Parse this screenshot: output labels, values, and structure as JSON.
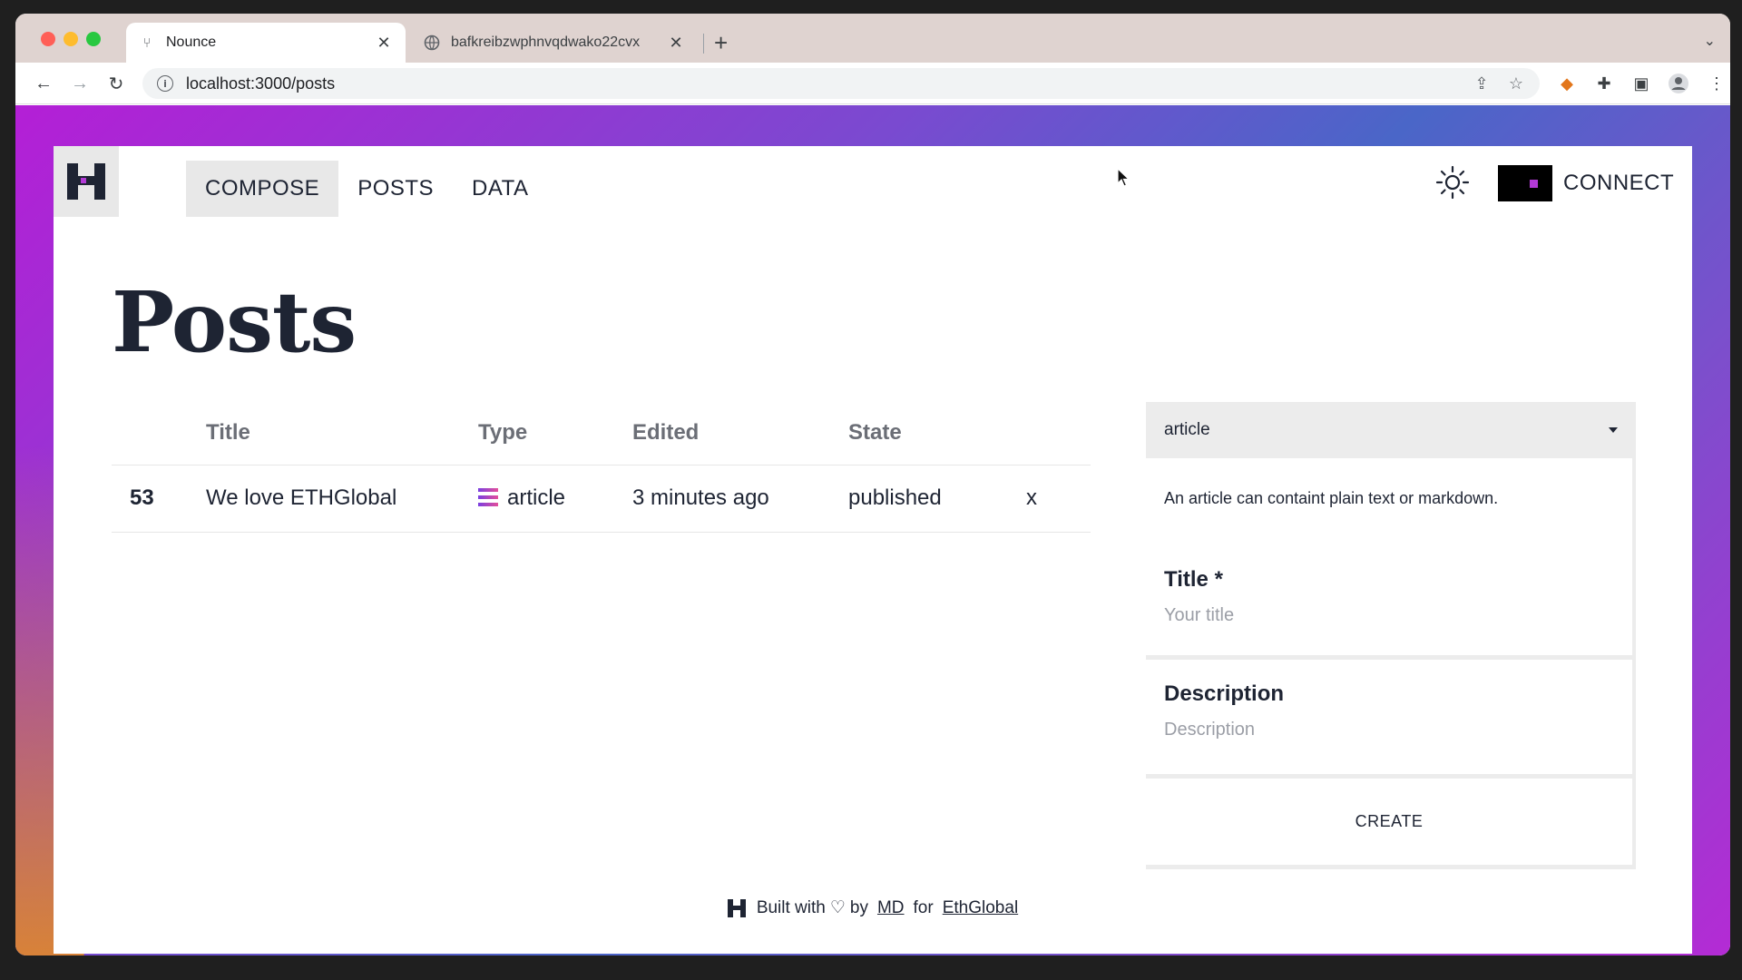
{
  "browser": {
    "tabs": [
      {
        "title": "Nounce",
        "icon": "github-like-icon",
        "close": "✕"
      },
      {
        "title": "bafkreibzwphnvqdwako22cvx",
        "icon": "globe-icon",
        "close": "✕"
      }
    ],
    "new_tab": "+",
    "url": "localhost:3000/posts"
  },
  "header": {
    "nav": [
      "COMPOSE",
      "POSTS",
      "DATA"
    ],
    "active_nav": "COMPOSE",
    "connect_label": "CONNECT"
  },
  "page": {
    "title": "Posts"
  },
  "table": {
    "headers": [
      "Title",
      "Type",
      "Edited",
      "State"
    ],
    "rows": [
      {
        "id": "53",
        "title": "We love ETHGlobal",
        "type": "article",
        "edited": "3 minutes ago",
        "state": "published",
        "action": "x"
      }
    ]
  },
  "form": {
    "type_selected": "article",
    "hint": "An article can containt plain text or markdown.",
    "title_label": "Title *",
    "title_placeholder": "Your title",
    "description_label": "Description",
    "description_placeholder": "Description",
    "create_label": "CREATE"
  },
  "footer": {
    "built_with": "Built with",
    "by": "by",
    "author": "MD",
    "for": "for",
    "event": "EthGlobal"
  },
  "colors": {
    "accent": "#b33ad6",
    "text": "#1e2433"
  }
}
